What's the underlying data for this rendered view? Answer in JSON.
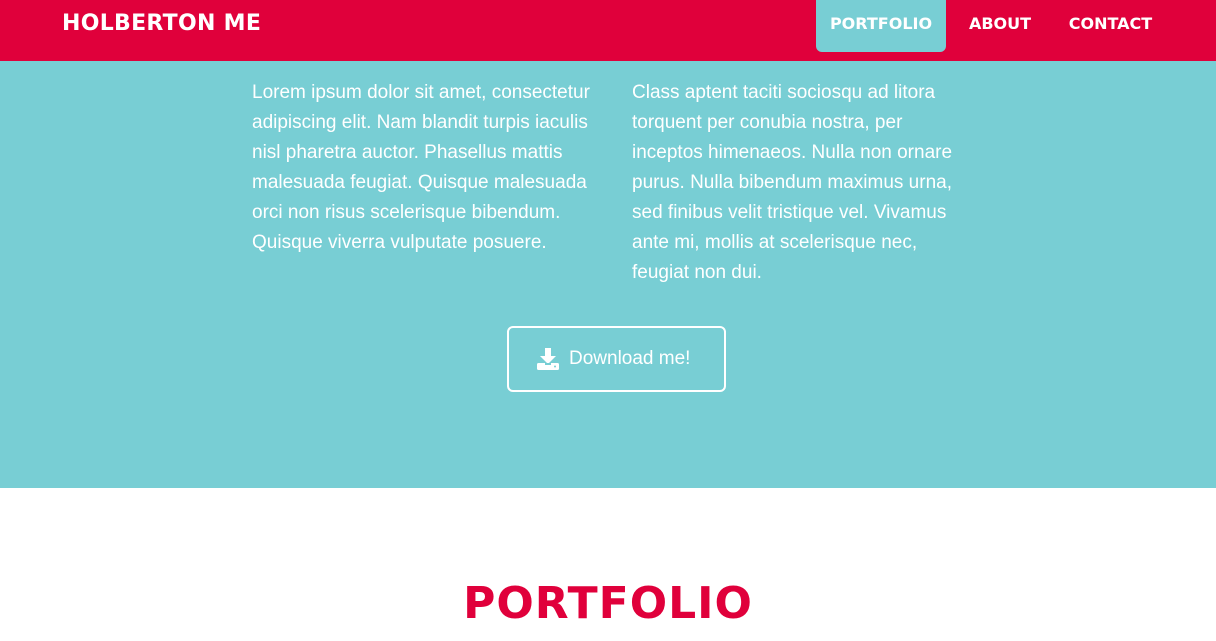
{
  "navbar": {
    "brand": "HOLBERTON ME",
    "items": [
      {
        "label": "PORTFOLIO",
        "active": true
      },
      {
        "label": "ABOUT",
        "active": false
      },
      {
        "label": "CONTACT",
        "active": false
      }
    ],
    "background_color": "#e0003b",
    "active_color": "#78ced4"
  },
  "hero": {
    "background_color": "#78ced4",
    "left_paragraph": "Lorem ipsum dolor sit amet, consectetur adipiscing elit. Nam blandit turpis iaculis nisl pharetra auctor. Phasellus mattis malesuada feugiat. Quisque malesuada orci non risus scelerisque bibendum. Quisque viverra vulputate posuere.",
    "right_paragraph": "Class aptent taciti sociosqu ad litora torquent per conubia nostra, per inceptos himenaeos. Nulla non ornare purus. Nulla bibendum maximus urna, sed finibus velit tristique vel. Vivamus ante mi, mollis at scelerisque nec, feugiat non dui.",
    "download_button": {
      "label": "Download me!",
      "icon": "download-icon"
    }
  },
  "portfolio_section": {
    "title": "PORTFOLIO",
    "title_color": "#e0003b"
  }
}
